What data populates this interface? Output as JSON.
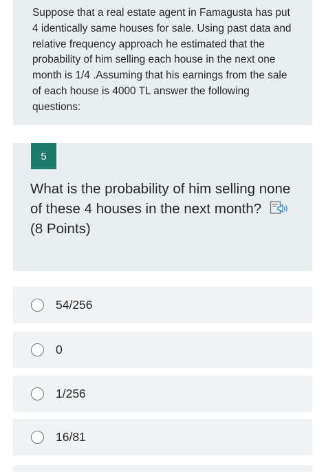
{
  "intro": {
    "text": "Suppose that a real estate agent in Famagusta has put 4 identically same houses for sale. Using past data and relative frequency approach he estimated that the probability of him selling each house in the next one month is 1/4  .Assuming that his earnings from the sale of each house is 4000 TL answer the following questions:"
  },
  "question": {
    "number": "5",
    "text": "What is the probability of him selling none of these 4 houses in the next month?",
    "points": "(8 Points)",
    "icon": "immersive-reader-icon"
  },
  "options": [
    {
      "label": "54/256",
      "selected": false
    },
    {
      "label": "0",
      "selected": false
    },
    {
      "label": "1/256",
      "selected": false
    },
    {
      "label": "16/81",
      "selected": false
    }
  ],
  "colors": {
    "card_bg": "#e9eef1",
    "option_bg": "#f1f2f3",
    "badge": "#1d7a6c",
    "icon_accent": "#2b8fd6"
  }
}
